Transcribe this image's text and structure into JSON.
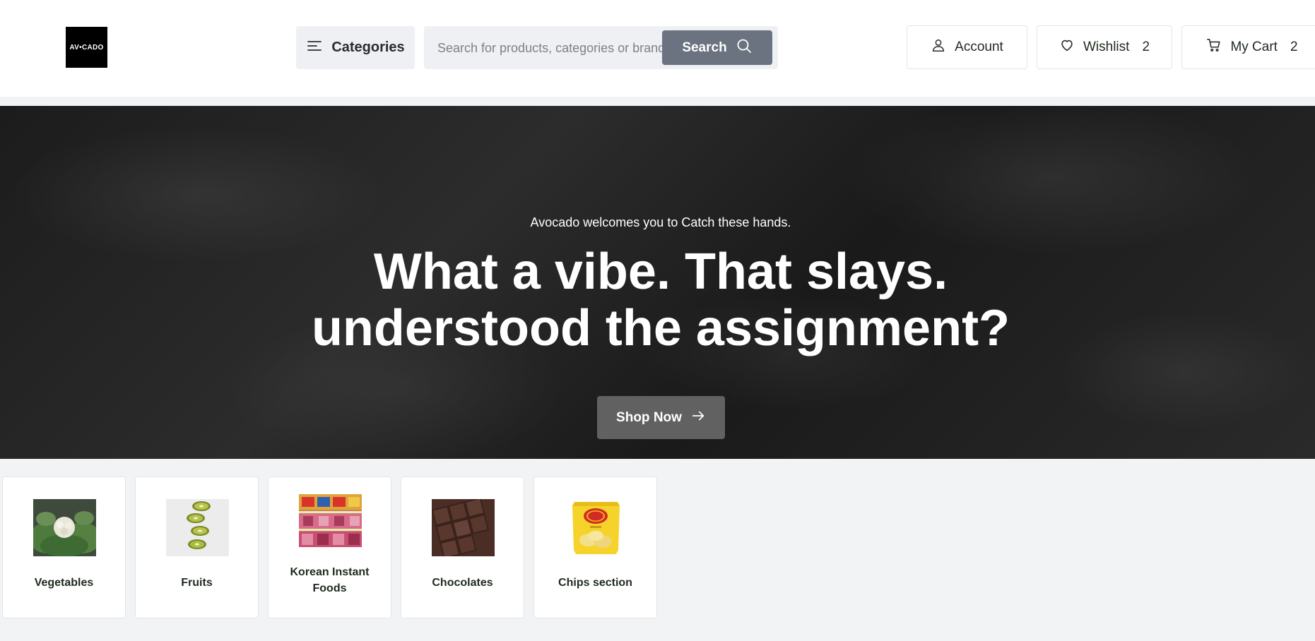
{
  "header": {
    "logo_text": "AV•CADO",
    "categories_label": "Categories",
    "search": {
      "placeholder": "Search for products, categories or brands",
      "button_label": "Search"
    },
    "account_label": "Account",
    "wishlist": {
      "label": "Wishlist",
      "count": "2"
    },
    "cart": {
      "label": "My Cart",
      "count": "2"
    }
  },
  "hero": {
    "subtitle": "Avocado welcomes you to Catch these hands.",
    "title_line1": "What a vibe. That slays.",
    "title_line2": "understood the assignment?",
    "cta_label": "Shop Now"
  },
  "categories": [
    {
      "label": "Vegetables",
      "icon": "vegetables-image"
    },
    {
      "label": "Fruits",
      "icon": "fruits-image"
    },
    {
      "label": "Korean Instant Foods",
      "icon": "korean-instant-foods-image"
    },
    {
      "label": "Chocolates",
      "icon": "chocolates-image"
    },
    {
      "label": "Chips section",
      "icon": "chips-image"
    }
  ],
  "colors": {
    "page_background": "#f2f3f5",
    "search_button": "#6b7280",
    "hero_button": "#616161",
    "logo_background": "#000000"
  }
}
